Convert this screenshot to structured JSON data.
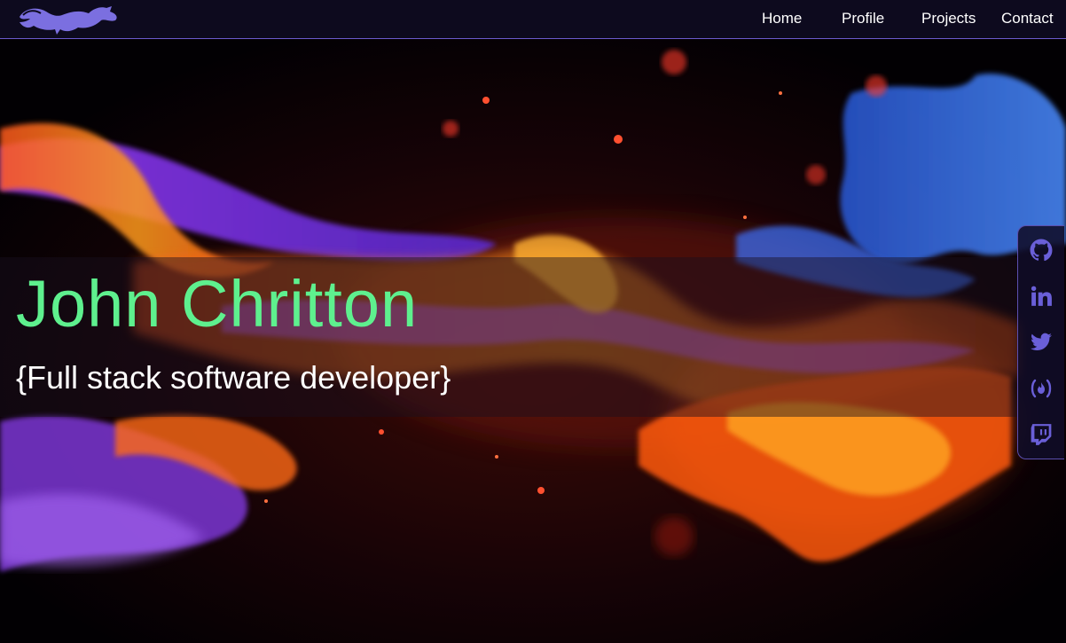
{
  "navbar": {
    "logo_icon": "dragon-logo-icon",
    "links": [
      {
        "label": "Home"
      },
      {
        "label": "Profile"
      },
      {
        "label": "Projects"
      },
      {
        "label": "Contact"
      }
    ]
  },
  "hero": {
    "name": "John Chritton",
    "subtitle": "{Full stack software developer}"
  },
  "social": {
    "icons": [
      "github-icon",
      "linkedin-icon",
      "twitter-icon",
      "freecodecamp-icon",
      "twitch-icon"
    ]
  },
  "colors": {
    "nav_bg": "#0d0a1e",
    "accent_purple": "#7b6fe0",
    "name_green": "#5ef08e",
    "sidebar_bg": "#100c28"
  }
}
